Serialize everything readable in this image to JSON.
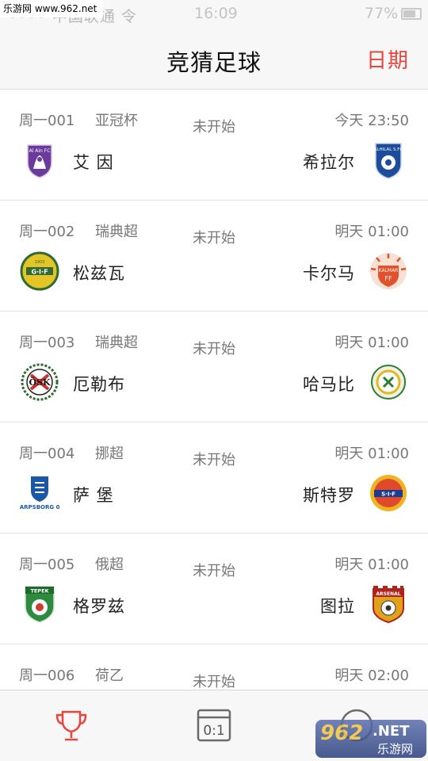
{
  "status_bar": {
    "carrier": "•••• 中国联通 令",
    "time": "16:09",
    "battery": "77%"
  },
  "watermark_top": "乐游网 www.962.net",
  "header": {
    "title": "竞猜足球",
    "date_button": "日期"
  },
  "matches": [
    {
      "no": "周一001",
      "league": "亚冠杯",
      "status": "未开始",
      "kickoff": "今天 23:50",
      "home": "艾 因",
      "away": "希拉尔",
      "home_logo": "al-ain-crest-icon",
      "away_logo": "al-hilal-crest-icon"
    },
    {
      "no": "周一002",
      "league": "瑞典超",
      "status": "未开始",
      "kickoff": "明天 01:00",
      "home": "松兹瓦",
      "away": "卡尔马",
      "home_logo": "gif-sundsvall-crest-icon",
      "away_logo": "kalmar-ff-crest-icon"
    },
    {
      "no": "周一003",
      "league": "瑞典超",
      "status": "未开始",
      "kickoff": "明天 01:00",
      "home": "厄勒布",
      "away": "哈马比",
      "home_logo": "orebro-crest-icon",
      "away_logo": "hammarby-crest-icon"
    },
    {
      "no": "周一004",
      "league": "挪超",
      "status": "未开始",
      "kickoff": "明天 01:00",
      "home": "萨 堡",
      "away": "斯特罗",
      "home_logo": "sarpsborg-crest-icon",
      "away_logo": "stromsgodset-crest-icon"
    },
    {
      "no": "周一005",
      "league": "俄超",
      "status": "未开始",
      "kickoff": "明天 01:00",
      "home": "格罗兹",
      "away": "图拉",
      "home_logo": "terek-crest-icon",
      "away_logo": "arsenal-tula-crest-icon"
    },
    {
      "no": "周一006",
      "league": "荷乙",
      "status": "未开始",
      "kickoff": "明天 02:00",
      "home": "",
      "away": "",
      "home_logo": "",
      "away_logo": ""
    }
  ],
  "tab_bar": {
    "tabs": [
      {
        "icon": "trophy-icon",
        "color": "#e8453c"
      },
      {
        "icon": "score-icon",
        "label": "0:1",
        "color": "#6b6b6b"
      },
      {
        "icon": "profile-icon",
        "color": "#6b6b6b"
      }
    ]
  },
  "watermark_bottom": {
    "number": "962",
    "net": ".NET",
    "cn": "乐游网"
  },
  "colors": {
    "accent": "#e8453c",
    "bar_bg": "#f7f7f7",
    "muted_text": "#777777"
  }
}
